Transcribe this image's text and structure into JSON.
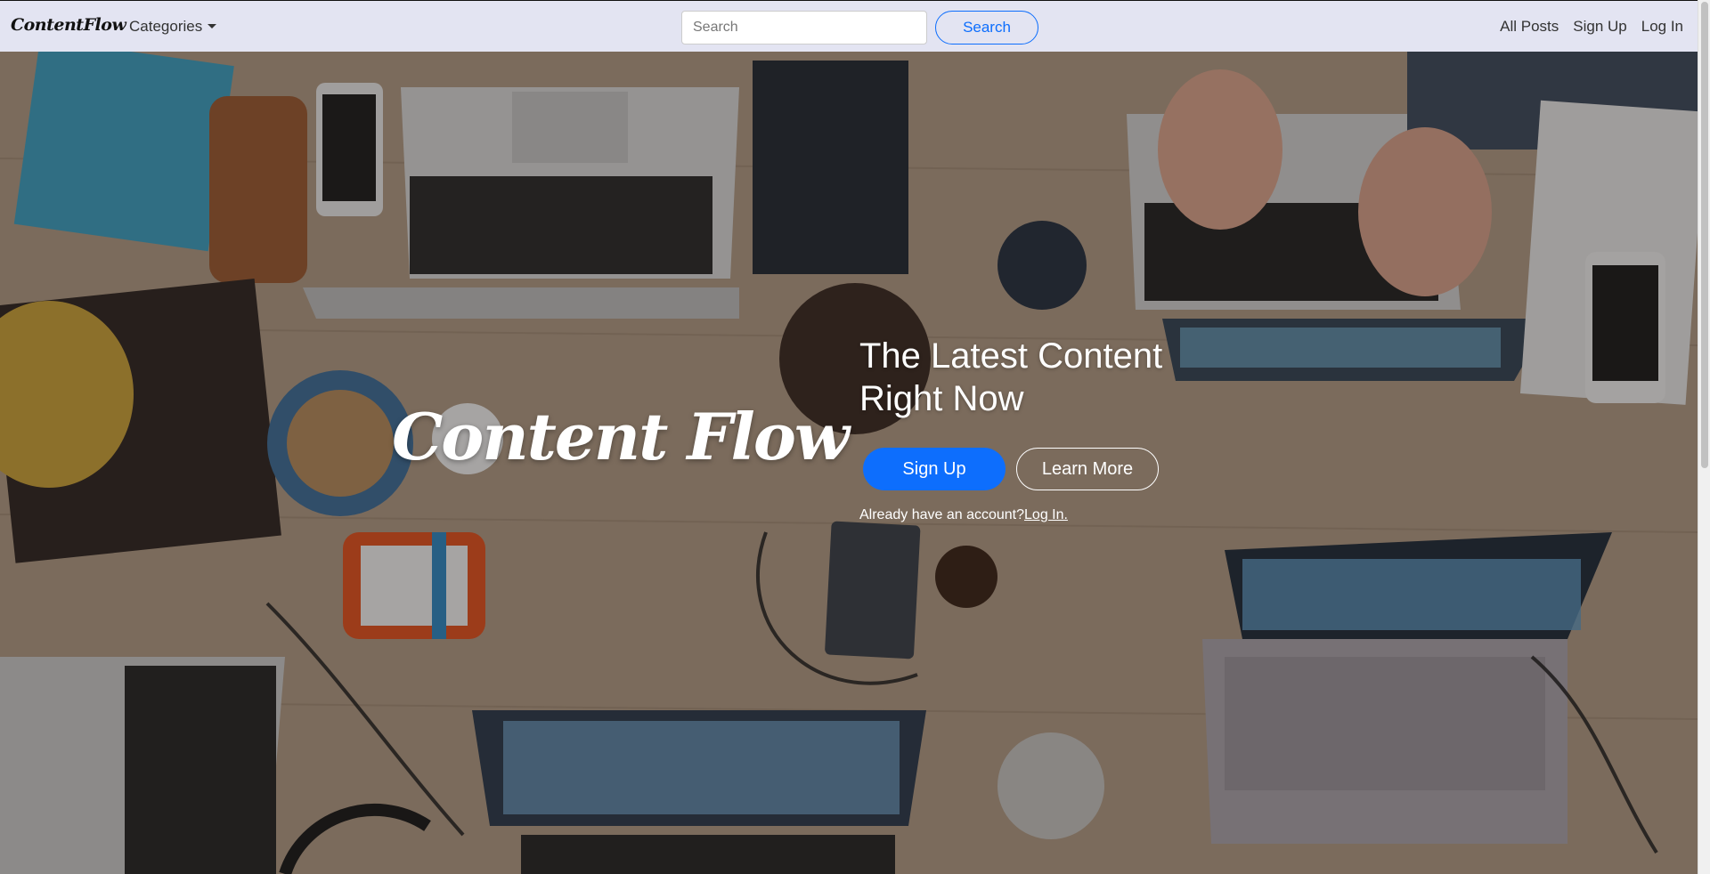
{
  "navbar": {
    "brand": "ContentFlow",
    "categories_label": "Categories",
    "search_placeholder": "Search",
    "search_button": "Search",
    "links": {
      "all_posts": "All Posts",
      "sign_up": "Sign Up",
      "log_in": "Log In"
    }
  },
  "hero": {
    "logo_text": "Content Flow",
    "headline": "The Latest Content Right Now",
    "signup_button": "Sign Up",
    "learn_more_button": "Learn More",
    "account_prompt": "Already have an account?",
    "login_link": "Log In."
  },
  "colors": {
    "navbar_bg": "#e3e4f2",
    "primary": "#0d6efd",
    "hero_text": "#ffffff"
  },
  "icons": {
    "categories_dropdown": "caret-down-icon"
  }
}
